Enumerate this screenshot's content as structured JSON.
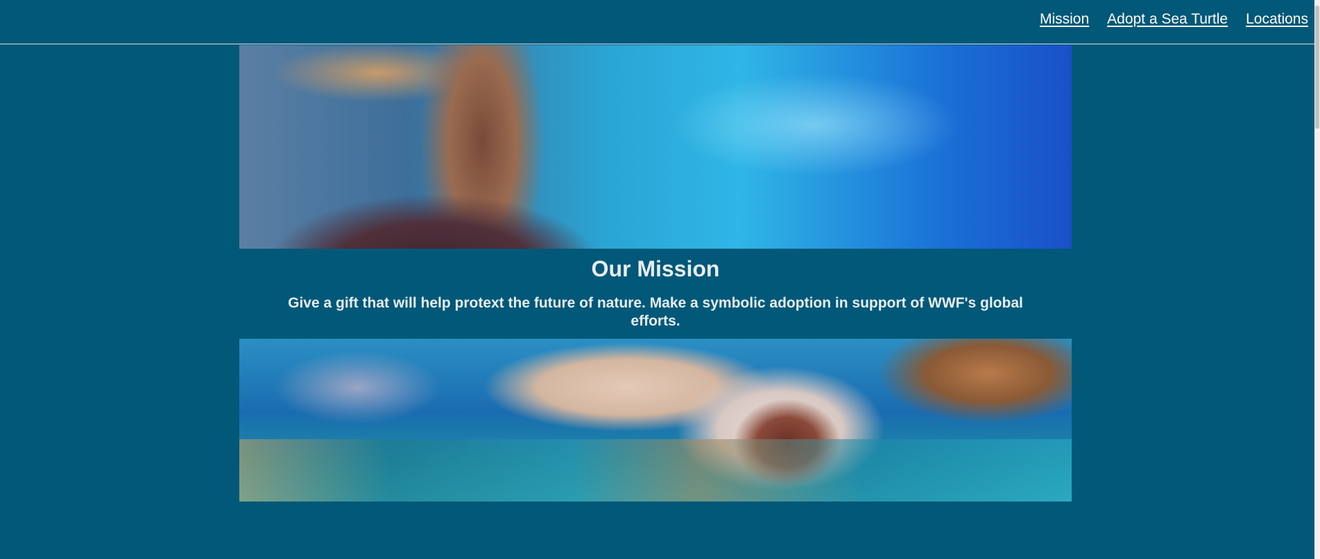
{
  "nav": {
    "links": [
      {
        "label": "Mission"
      },
      {
        "label": "Adopt a Sea Turtle"
      },
      {
        "label": "Locations"
      }
    ]
  },
  "mission": {
    "title": "Our Mission",
    "text": "Give a gift that will help protext the future of nature. Make a symbolic adoption in support of WWF's global efforts."
  },
  "images": {
    "top": "sea turtle swimming under water surface",
    "bottom": "sea turtle swimming over coral reef with fish"
  },
  "colors": {
    "background": "#025878",
    "text": "#e7eef2",
    "link": "#ffffff",
    "divider": "#d5e3ea"
  }
}
